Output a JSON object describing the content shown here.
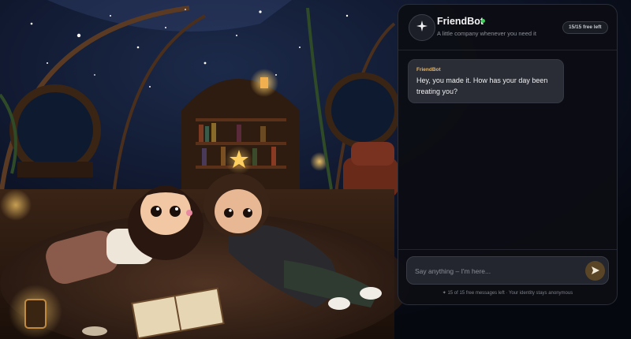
{
  "bot": {
    "name": "FriendBot",
    "subtitle": "A little company whenever you need it",
    "status": "online",
    "limit_badge": "15/15 free left"
  },
  "messages": [
    {
      "sender": "FriendBot",
      "text": "Hey, you made it. How has your day been treating you?"
    }
  ],
  "composer": {
    "placeholder": "Say anything – I'm here...",
    "send_icon": "send-icon"
  },
  "footer": {
    "note": "✦ 15 of 15 free messages left · Your identity stays anonymous"
  },
  "colors": {
    "accent": "#e8b25a",
    "online": "#3ecf5a",
    "send_button": "#5a4527",
    "panel_bg": "#0c0e14"
  },
  "background": {
    "description_icon": "cozy-night-illustration"
  }
}
